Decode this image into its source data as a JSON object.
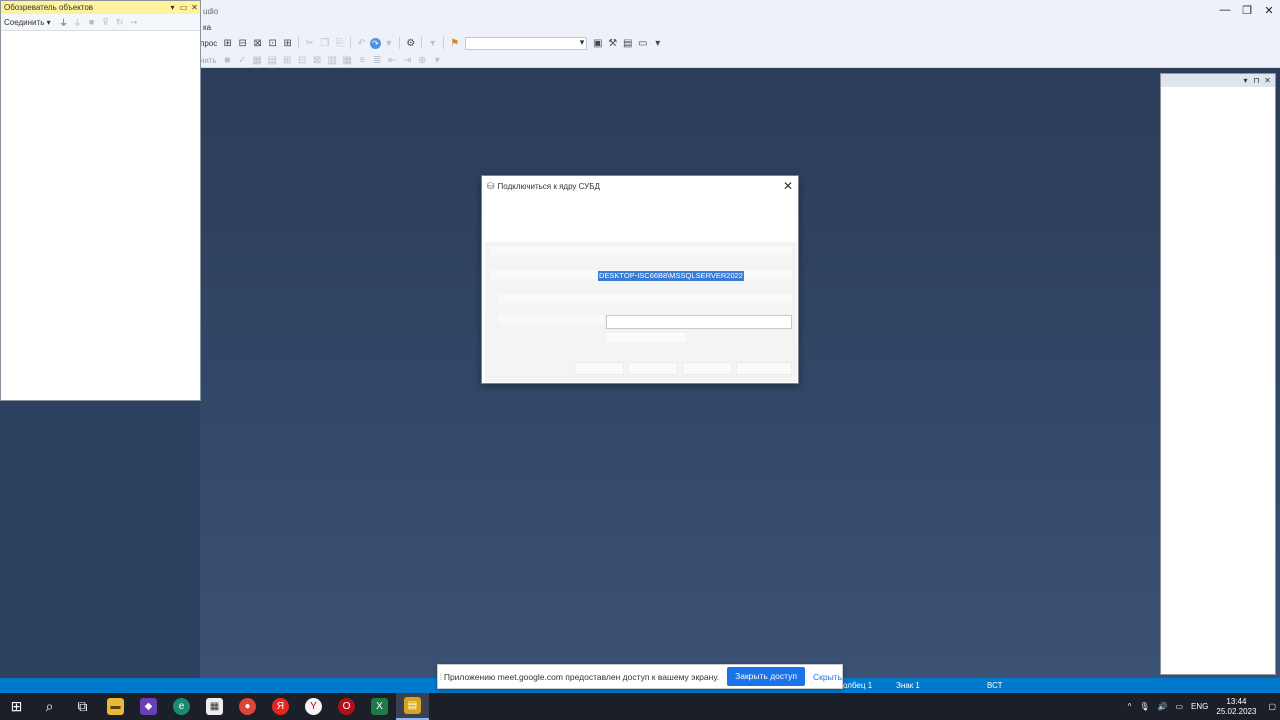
{
  "app": {
    "title_fragment": "udio",
    "menu_fragment": "ка",
    "toolbar_label": "прос",
    "toolbar2_label": "нить",
    "window_controls": {
      "minimize": "—",
      "restore": "❐",
      "close": "✕"
    }
  },
  "object_explorer": {
    "title": "Обозреватель объектов",
    "connect_label": "Соединить ▾",
    "controls": {
      "pin": "▾",
      "maximize": "▭",
      "close": "✕"
    }
  },
  "properties_panel": {
    "controls": {
      "dropdown": "▾",
      "pin": "⊓",
      "close": "✕"
    }
  },
  "connect_dialog": {
    "title": "Подключиться к ядру СУБД",
    "icon": "server-connect-icon",
    "close": "✕",
    "server_name": "DESKTOP-ISC66B8\\MSSQLSERVER2022"
  },
  "statusbar": {
    "column": "олбец 1",
    "char": "Знак 1",
    "mode": "ВСТ"
  },
  "share_notification": {
    "message": "Приложению meet.google.com предоставлен доступ к вашему экрану.",
    "stop_label": "Закрыть доступ",
    "hide_label": "Скрыть"
  },
  "tray": {
    "language": "ENG",
    "time": "13:44",
    "date": "25.02.2023"
  },
  "colors": {
    "statusbar": "#007acc",
    "selection": "#3a7bd5",
    "share_button": "#1a73e8",
    "workspace": "#2d4260"
  }
}
